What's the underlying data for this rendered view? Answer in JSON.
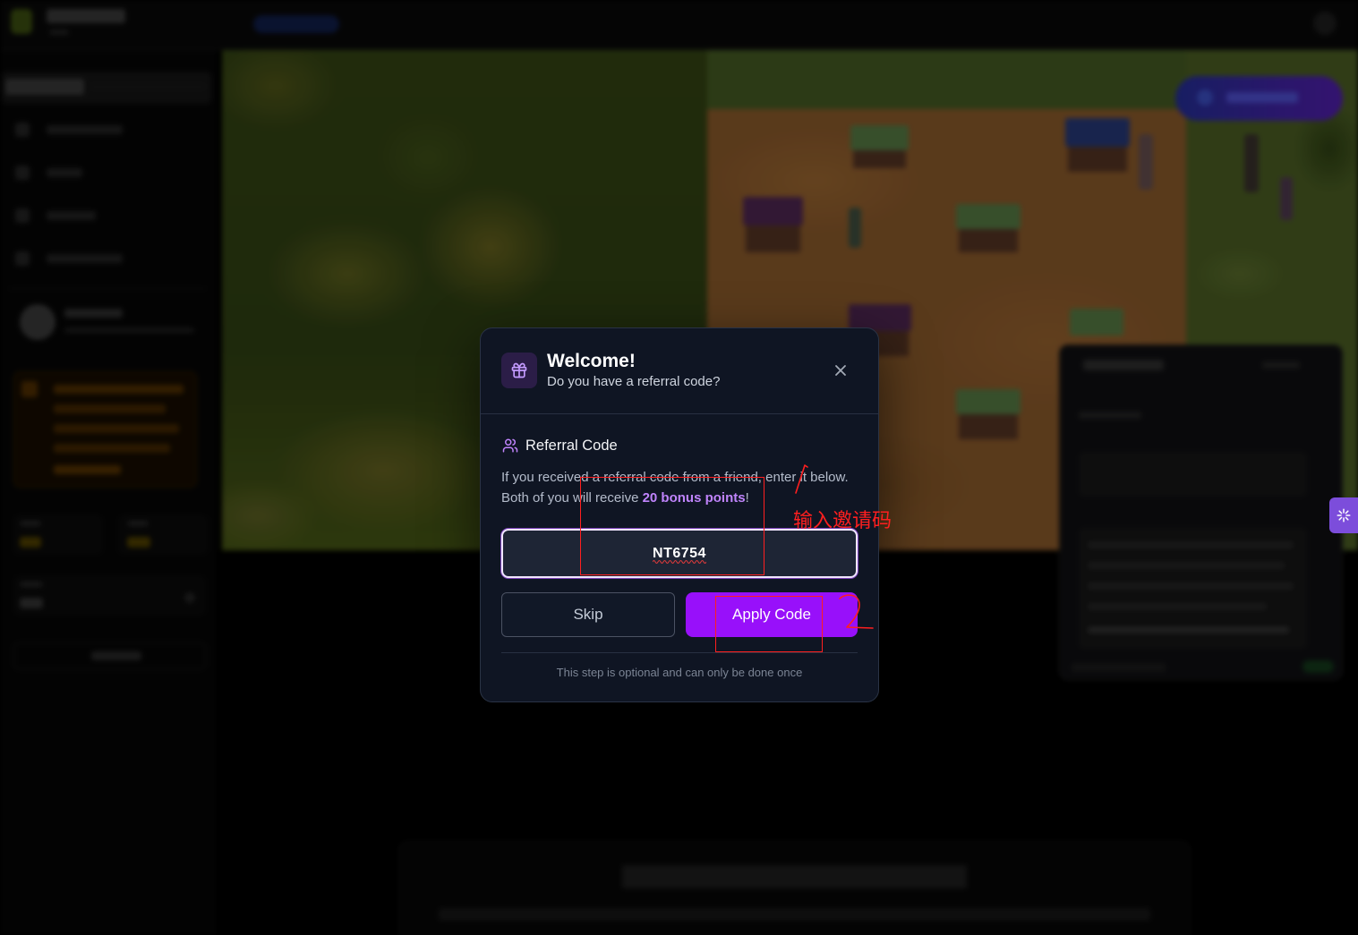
{
  "modal": {
    "header_icon": "gift-icon",
    "title": "Welcome!",
    "subtitle": "Do you have a referral code?",
    "close_icon": "close-icon",
    "section_icon": "users-icon",
    "section_heading": "Referral Code",
    "description_sentence": "If you received a referral code from a friend, enter it below.",
    "description_reward_prefix": "Both of you will receive ",
    "description_reward_highlight": "20 bonus points",
    "description_reward_suffix": "!",
    "referral_input_value": "NT6754",
    "skip_label": "Skip",
    "apply_label": "Apply Code",
    "footer_note": "This step is optional and can only be done once"
  },
  "annotations": {
    "instruction_text": "输入邀请码",
    "step_marks": [
      "1",
      "2"
    ],
    "color": "#ff1f1f"
  },
  "side_tab": {
    "icon": "sparkle-icon"
  },
  "colors": {
    "accent_purple": "#9810fa",
    "highlight_purple": "#c084fc",
    "modal_background": "#0f1523",
    "side_tab_purple": "#7c4ddb"
  }
}
